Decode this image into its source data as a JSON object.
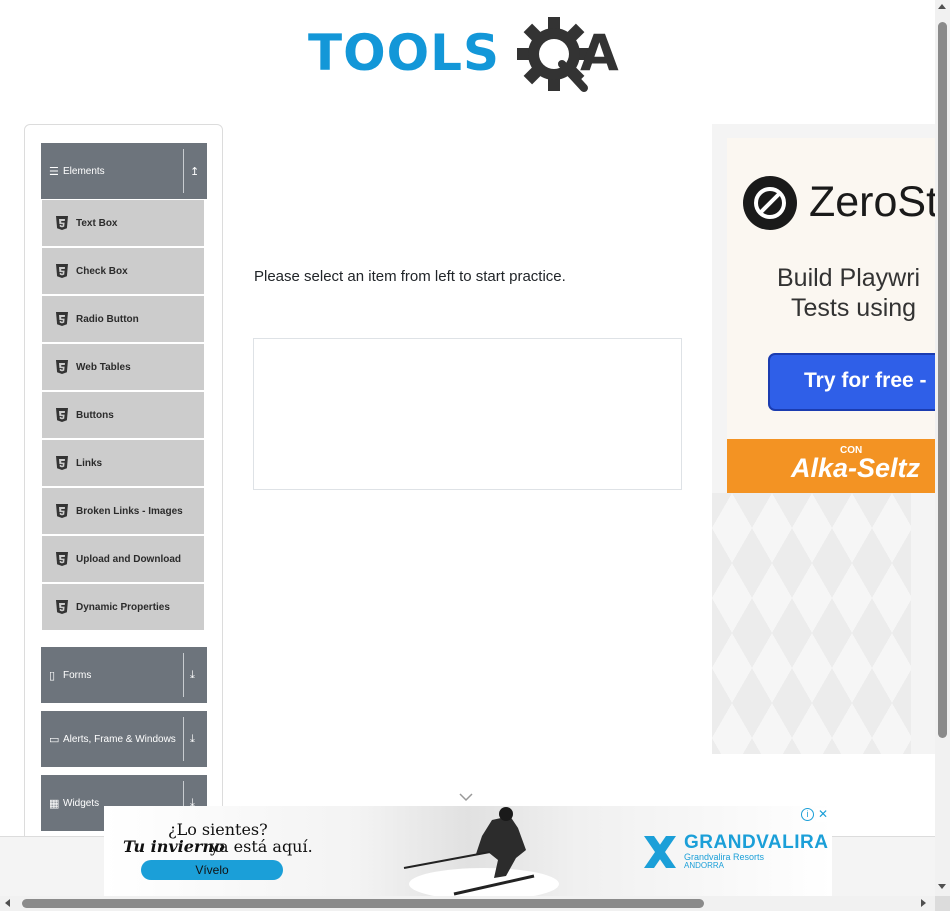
{
  "logo": {
    "text": "TOOLS",
    "suffix": "A"
  },
  "sidebar": {
    "groups": [
      {
        "label": "Elements",
        "icon": "hamburger-icon",
        "arrow": "↥",
        "expanded": true
      },
      {
        "label": "Forms",
        "icon": "document-icon",
        "arrow": "⤓",
        "expanded": false
      },
      {
        "label": "Alerts, Frame & Windows",
        "icon": "window-icon",
        "arrow": "⤓",
        "expanded": false
      },
      {
        "label": "Widgets",
        "icon": "grid-icon",
        "arrow": "⤓",
        "expanded": false
      }
    ],
    "items": [
      {
        "label": "Text Box",
        "icon": "html5-icon"
      },
      {
        "label": "Check Box",
        "icon": "html5-icon"
      },
      {
        "label": "Radio Button",
        "icon": "html5-icon"
      },
      {
        "label": "Web Tables",
        "icon": "html5-icon"
      },
      {
        "label": "Buttons",
        "icon": "html5-icon"
      },
      {
        "label": "Links",
        "icon": "html5-icon"
      },
      {
        "label": "Broken Links - Images",
        "icon": "html5-icon"
      },
      {
        "label": "Upload and Download",
        "icon": "html5-icon"
      },
      {
        "label": "Dynamic Properties",
        "icon": "html5-icon"
      }
    ]
  },
  "main": {
    "message": "Please select an item from left to start practice."
  },
  "right_ad": {
    "brand": "ZeroSt",
    "line1": "Build Playwri",
    "line2": "Tests using",
    "button": "Try for free -",
    "banner_small": "CON",
    "banner_name": "Alka-Seltz"
  },
  "bottom_ad": {
    "line1": "¿Lo sientes?",
    "line2_italic": "Tu invierno",
    "line2_rest": "ya está aquí.",
    "button": "Vívelo",
    "brand": "GRANDVALIRA",
    "brand_sub": "Grandvalira Resorts",
    "brand_sub2": "ANDORRA",
    "info": "i",
    "close": "✕"
  },
  "colors": {
    "brand_blue": "#1397d8",
    "brand_dark": "#333333",
    "group_header_bg": "#6d747c",
    "menu_item_bg": "#cccccc",
    "ad_button_blue": "#2f5fe8",
    "ad_orange": "#f39323"
  }
}
